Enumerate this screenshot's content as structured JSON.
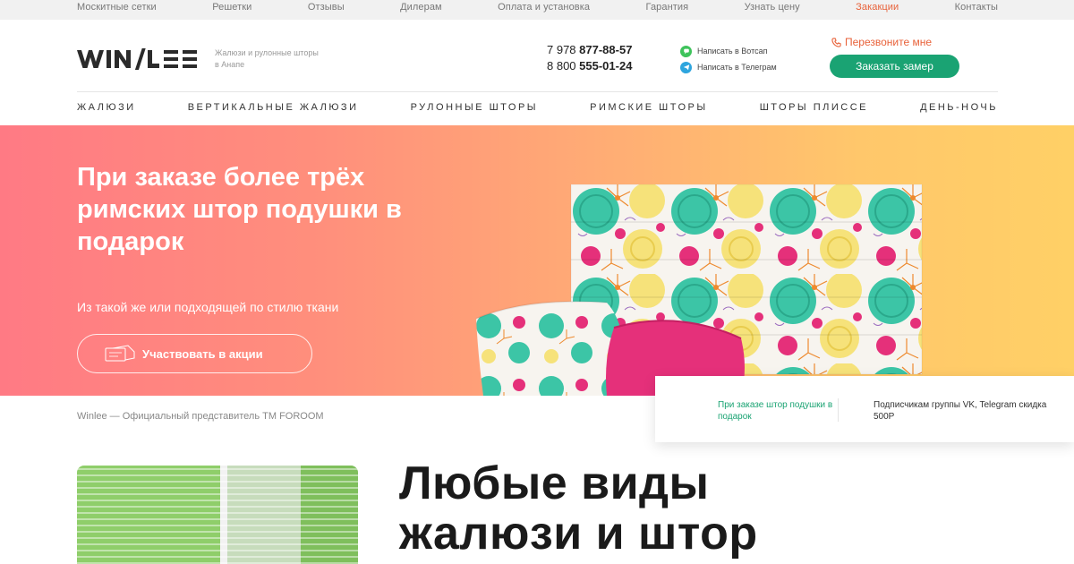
{
  "topnav": [
    {
      "label": "Москитные сетки",
      "active": false
    },
    {
      "label": "Решетки",
      "active": false
    },
    {
      "label": "Отзывы",
      "active": false
    },
    {
      "label": "Дилерам",
      "active": false
    },
    {
      "label": "Оплата и установка",
      "active": false
    },
    {
      "label": "Гарантия",
      "active": false
    },
    {
      "label": "Узнать цену",
      "active": false
    },
    {
      "label": "Закакции",
      "active": true
    },
    {
      "label": "Контакты",
      "active": false
    }
  ],
  "header": {
    "logo_text": "WINLEE",
    "tagline": "Жалюзи и рулонные шторы в Анапе",
    "phone1_prefix": "7 978 ",
    "phone1_main": "877-88-57",
    "phone2_prefix": "8 800 ",
    "phone2_main": "555-01-24",
    "whatsapp_label": "Написать в Вотсап",
    "telegram_label": "Написать в Телеграм",
    "callback_label": "Перезвоните мне",
    "order_button": "Заказать замер"
  },
  "mainnav": [
    "ЖАЛЮЗИ",
    "ВЕРТИКАЛЬНЫЕ ЖАЛЮЗИ",
    "РУЛОННЫЕ ШТОРЫ",
    "РИМСКИЕ ШТОРЫ",
    "ШТОРЫ ПЛИССЕ",
    "ДЕНЬ-НОЧЬ"
  ],
  "hero": {
    "title": "При заказе более трёх римских штор подушки в подарок",
    "subtitle": "Из такой же или подходящей по стилю ткани",
    "button": "Участвовать в акции"
  },
  "promo_card": {
    "item1": "При заказе штор подушки в подарок",
    "item2": "Подписчикам группы VK, Telegram скидка 500Р"
  },
  "official": "Winlee — Официальный представитель ТМ FOROOM",
  "section_title_line1": "Любые виды",
  "section_title_line2": "жалюзи и штор",
  "colors": {
    "accent_green": "#1aa373",
    "accent_orange": "#e8623a",
    "hero_gradient_start": "#ff7a84",
    "hero_gradient_end": "#ffd066"
  }
}
